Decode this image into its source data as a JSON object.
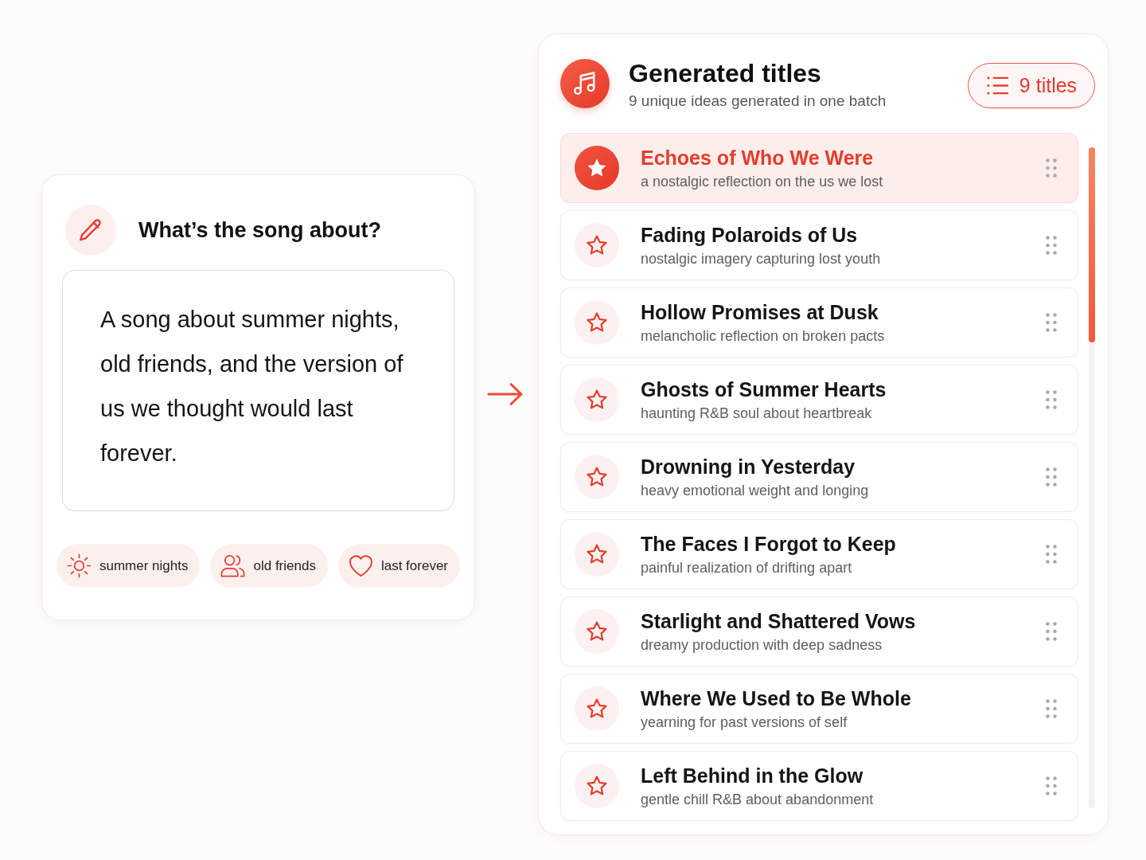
{
  "prompt_card": {
    "heading": "What’s the song about?",
    "description": "A song about summer nights, old friends, and the version of us we thought would last forever.",
    "tags": [
      "summer nights",
      "old friends",
      "last forever"
    ]
  },
  "results": {
    "title": "Generated titles",
    "subtitle": "9 unique ideas generated in one batch",
    "count_badge": "9 titles",
    "items": [
      {
        "title": "Echoes of Who We Were",
        "description": "a nostalgic reflection on the us we lost",
        "selected": true
      },
      {
        "title": "Fading Polaroids of Us",
        "description": "nostalgic imagery capturing lost youth",
        "selected": false
      },
      {
        "title": "Hollow Promises at Dusk",
        "description": "melancholic reflection on broken pacts",
        "selected": false
      },
      {
        "title": "Ghosts of Summer Hearts",
        "description": "haunting R&B soul about heartbreak",
        "selected": false
      },
      {
        "title": "Drowning in Yesterday",
        "description": "heavy emotional weight and longing",
        "selected": false
      },
      {
        "title": "The Faces I Forgot to Keep",
        "description": "painful realization of drifting apart",
        "selected": false
      },
      {
        "title": "Starlight and Shattered Vows",
        "description": "dreamy production with deep sadness",
        "selected": false
      },
      {
        "title": "Where We Used to Be Whole",
        "description": "yearning for past versions of self",
        "selected": false
      },
      {
        "title": "Left Behind in the Glow",
        "description": "gentle chill R&B about abandonment",
        "selected": false
      }
    ]
  }
}
